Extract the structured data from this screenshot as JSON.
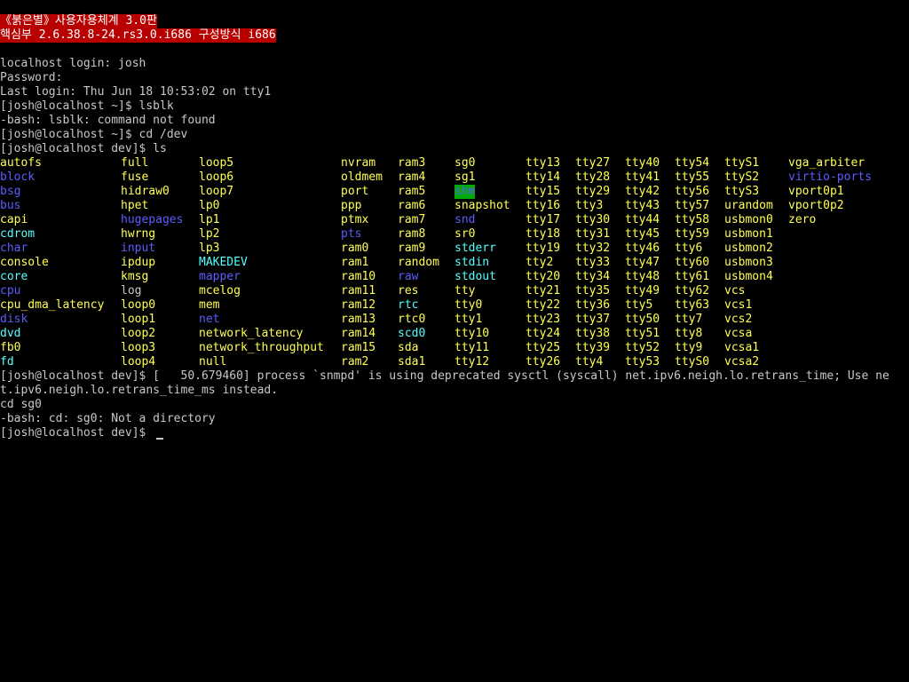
{
  "colors": {
    "background": "#000000",
    "text": "#c8c8c8",
    "banner_bg": "#b80000",
    "banner_text": "#ffffff",
    "directory": "#5c5cff",
    "device": "#ffff54",
    "symlink": "#54ffff",
    "sticky_bg": "#00aa00"
  },
  "banner": {
    "line1": "《붉은별》사용자용체계 3.0판",
    "line2": "핵심부 2.6.38.8-24.rs3.0.i686 구성방식 i686"
  },
  "session": {
    "login_line": "localhost login: josh",
    "password_line": "Password:",
    "last_login_line": "Last login: Thu Jun 18 10:53:02 on tty1",
    "cmd_lsblk": "[josh@localhost ~]$ lsblk",
    "lsblk_error": "-bash: lsblk: command not found",
    "cmd_cd": "[josh@localhost ~]$ cd /dev",
    "cmd_ls": "[josh@localhost dev]$ ls"
  },
  "ls_columns": [
    [
      {
        "name": "autofs",
        "type": "dev"
      },
      {
        "name": "block",
        "type": "dir"
      },
      {
        "name": "bsg",
        "type": "dir"
      },
      {
        "name": "bus",
        "type": "dir"
      },
      {
        "name": "capi",
        "type": "dev"
      },
      {
        "name": "cdrom",
        "type": "link"
      },
      {
        "name": "char",
        "type": "dir"
      },
      {
        "name": "console",
        "type": "dev"
      },
      {
        "name": "core",
        "type": "link"
      },
      {
        "name": "cpu",
        "type": "dir"
      },
      {
        "name": "cpu_dma_latency",
        "type": "dev"
      },
      {
        "name": "disk",
        "type": "dir"
      },
      {
        "name": "dvd",
        "type": "link"
      },
      {
        "name": "fb0",
        "type": "dev"
      },
      {
        "name": "fd",
        "type": "link"
      }
    ],
    [
      {
        "name": "full",
        "type": "dev"
      },
      {
        "name": "fuse",
        "type": "dev"
      },
      {
        "name": "hidraw0",
        "type": "dev"
      },
      {
        "name": "hpet",
        "type": "dev"
      },
      {
        "name": "hugepages",
        "type": "dir"
      },
      {
        "name": "hwrng",
        "type": "dev"
      },
      {
        "name": "input",
        "type": "dir"
      },
      {
        "name": "ipdup",
        "type": "dev"
      },
      {
        "name": "kmsg",
        "type": "dev"
      },
      {
        "name": "log",
        "type": "file"
      },
      {
        "name": "loop0",
        "type": "dev"
      },
      {
        "name": "loop1",
        "type": "dev"
      },
      {
        "name": "loop2",
        "type": "dev"
      },
      {
        "name": "loop3",
        "type": "dev"
      },
      {
        "name": "loop4",
        "type": "dev"
      }
    ],
    [
      {
        "name": "loop5",
        "type": "dev"
      },
      {
        "name": "loop6",
        "type": "dev"
      },
      {
        "name": "loop7",
        "type": "dev"
      },
      {
        "name": "lp0",
        "type": "dev"
      },
      {
        "name": "lp1",
        "type": "dev"
      },
      {
        "name": "lp2",
        "type": "dev"
      },
      {
        "name": "lp3",
        "type": "dev"
      },
      {
        "name": "MAKEDEV",
        "type": "link"
      },
      {
        "name": "mapper",
        "type": "dir"
      },
      {
        "name": "mcelog",
        "type": "dev"
      },
      {
        "name": "mem",
        "type": "dev"
      },
      {
        "name": "net",
        "type": "dir"
      },
      {
        "name": "network_latency",
        "type": "dev"
      },
      {
        "name": "network_throughput",
        "type": "dev"
      },
      {
        "name": "null",
        "type": "dev"
      }
    ],
    [
      {
        "name": "nvram",
        "type": "dev"
      },
      {
        "name": "oldmem",
        "type": "dev"
      },
      {
        "name": "port",
        "type": "dev"
      },
      {
        "name": "ppp",
        "type": "dev"
      },
      {
        "name": "ptmx",
        "type": "dev"
      },
      {
        "name": "pts",
        "type": "dir"
      },
      {
        "name": "ram0",
        "type": "dev"
      },
      {
        "name": "ram1",
        "type": "dev"
      },
      {
        "name": "ram10",
        "type": "dev"
      },
      {
        "name": "ram11",
        "type": "dev"
      },
      {
        "name": "ram12",
        "type": "dev"
      },
      {
        "name": "ram13",
        "type": "dev"
      },
      {
        "name": "ram14",
        "type": "dev"
      },
      {
        "name": "ram15",
        "type": "dev"
      },
      {
        "name": "ram2",
        "type": "dev"
      }
    ],
    [
      {
        "name": "ram3",
        "type": "dev"
      },
      {
        "name": "ram4",
        "type": "dev"
      },
      {
        "name": "ram5",
        "type": "dev"
      },
      {
        "name": "ram6",
        "type": "dev"
      },
      {
        "name": "ram7",
        "type": "dev"
      },
      {
        "name": "ram8",
        "type": "dev"
      },
      {
        "name": "ram9",
        "type": "dev"
      },
      {
        "name": "random",
        "type": "dev"
      },
      {
        "name": "raw",
        "type": "dir"
      },
      {
        "name": "res",
        "type": "dev"
      },
      {
        "name": "rtc",
        "type": "link"
      },
      {
        "name": "rtc0",
        "type": "dev"
      },
      {
        "name": "scd0",
        "type": "link"
      },
      {
        "name": "sda",
        "type": "dev"
      },
      {
        "name": "sda1",
        "type": "dev"
      }
    ],
    [
      {
        "name": "sg0",
        "type": "dev"
      },
      {
        "name": "sg1",
        "type": "dev"
      },
      {
        "name": "shm",
        "type": "sticky"
      },
      {
        "name": "snapshot",
        "type": "dev"
      },
      {
        "name": "snd",
        "type": "dir"
      },
      {
        "name": "sr0",
        "type": "dev"
      },
      {
        "name": "stderr",
        "type": "link"
      },
      {
        "name": "stdin",
        "type": "link"
      },
      {
        "name": "stdout",
        "type": "link"
      },
      {
        "name": "tty",
        "type": "dev"
      },
      {
        "name": "tty0",
        "type": "dev"
      },
      {
        "name": "tty1",
        "type": "dev"
      },
      {
        "name": "tty10",
        "type": "dev"
      },
      {
        "name": "tty11",
        "type": "dev"
      },
      {
        "name": "tty12",
        "type": "dev"
      }
    ],
    [
      {
        "name": "tty13",
        "type": "dev"
      },
      {
        "name": "tty14",
        "type": "dev"
      },
      {
        "name": "tty15",
        "type": "dev"
      },
      {
        "name": "tty16",
        "type": "dev"
      },
      {
        "name": "tty17",
        "type": "dev"
      },
      {
        "name": "tty18",
        "type": "dev"
      },
      {
        "name": "tty19",
        "type": "dev"
      },
      {
        "name": "tty2",
        "type": "dev"
      },
      {
        "name": "tty20",
        "type": "dev"
      },
      {
        "name": "tty21",
        "type": "dev"
      },
      {
        "name": "tty22",
        "type": "dev"
      },
      {
        "name": "tty23",
        "type": "dev"
      },
      {
        "name": "tty24",
        "type": "dev"
      },
      {
        "name": "tty25",
        "type": "dev"
      },
      {
        "name": "tty26",
        "type": "dev"
      }
    ],
    [
      {
        "name": "tty27",
        "type": "dev"
      },
      {
        "name": "tty28",
        "type": "dev"
      },
      {
        "name": "tty29",
        "type": "dev"
      },
      {
        "name": "tty3",
        "type": "dev"
      },
      {
        "name": "tty30",
        "type": "dev"
      },
      {
        "name": "tty31",
        "type": "dev"
      },
      {
        "name": "tty32",
        "type": "dev"
      },
      {
        "name": "tty33",
        "type": "dev"
      },
      {
        "name": "tty34",
        "type": "dev"
      },
      {
        "name": "tty35",
        "type": "dev"
      },
      {
        "name": "tty36",
        "type": "dev"
      },
      {
        "name": "tty37",
        "type": "dev"
      },
      {
        "name": "tty38",
        "type": "dev"
      },
      {
        "name": "tty39",
        "type": "dev"
      },
      {
        "name": "tty4",
        "type": "dev"
      }
    ],
    [
      {
        "name": "tty40",
        "type": "dev"
      },
      {
        "name": "tty41",
        "type": "dev"
      },
      {
        "name": "tty42",
        "type": "dev"
      },
      {
        "name": "tty43",
        "type": "dev"
      },
      {
        "name": "tty44",
        "type": "dev"
      },
      {
        "name": "tty45",
        "type": "dev"
      },
      {
        "name": "tty46",
        "type": "dev"
      },
      {
        "name": "tty47",
        "type": "dev"
      },
      {
        "name": "tty48",
        "type": "dev"
      },
      {
        "name": "tty49",
        "type": "dev"
      },
      {
        "name": "tty5",
        "type": "dev"
      },
      {
        "name": "tty50",
        "type": "dev"
      },
      {
        "name": "tty51",
        "type": "dev"
      },
      {
        "name": "tty52",
        "type": "dev"
      },
      {
        "name": "tty53",
        "type": "dev"
      }
    ],
    [
      {
        "name": "tty54",
        "type": "dev"
      },
      {
        "name": "tty55",
        "type": "dev"
      },
      {
        "name": "tty56",
        "type": "dev"
      },
      {
        "name": "tty57",
        "type": "dev"
      },
      {
        "name": "tty58",
        "type": "dev"
      },
      {
        "name": "tty59",
        "type": "dev"
      },
      {
        "name": "tty6",
        "type": "dev"
      },
      {
        "name": "tty60",
        "type": "dev"
      },
      {
        "name": "tty61",
        "type": "dev"
      },
      {
        "name": "tty62",
        "type": "dev"
      },
      {
        "name": "tty63",
        "type": "dev"
      },
      {
        "name": "tty7",
        "type": "dev"
      },
      {
        "name": "tty8",
        "type": "dev"
      },
      {
        "name": "tty9",
        "type": "dev"
      },
      {
        "name": "ttyS0",
        "type": "dev"
      }
    ],
    [
      {
        "name": "ttyS1",
        "type": "dev"
      },
      {
        "name": "ttyS2",
        "type": "dev"
      },
      {
        "name": "ttyS3",
        "type": "dev"
      },
      {
        "name": "urandom",
        "type": "dev"
      },
      {
        "name": "usbmon0",
        "type": "dev"
      },
      {
        "name": "usbmon1",
        "type": "dev"
      },
      {
        "name": "usbmon2",
        "type": "dev"
      },
      {
        "name": "usbmon3",
        "type": "dev"
      },
      {
        "name": "usbmon4",
        "type": "dev"
      },
      {
        "name": "vcs",
        "type": "dev"
      },
      {
        "name": "vcs1",
        "type": "dev"
      },
      {
        "name": "vcs2",
        "type": "dev"
      },
      {
        "name": "vcsa",
        "type": "dev"
      },
      {
        "name": "vcsa1",
        "type": "dev"
      },
      {
        "name": "vcsa2",
        "type": "dev"
      }
    ],
    [
      {
        "name": "vga_arbiter",
        "type": "dev"
      },
      {
        "name": "virtio-ports",
        "type": "dir"
      },
      {
        "name": "vport0p1",
        "type": "dev"
      },
      {
        "name": "vport0p2",
        "type": "dev"
      },
      {
        "name": "zero",
        "type": "dev"
      }
    ]
  ],
  "after_ls": {
    "kernel_msg_line1": "[josh@localhost dev]$ [   50.679460] process `snmpd' is using deprecated sysctl (syscall) net.ipv6.neigh.lo.retrans_time; Use ne",
    "kernel_msg_line2": "t.ipv6.neigh.lo.retrans_time_ms instead.",
    "cmd_cd_sg0": "cd sg0",
    "cd_error": "-bash: cd: sg0: Not a directory",
    "final_prompt": "[josh@localhost dev]$"
  }
}
